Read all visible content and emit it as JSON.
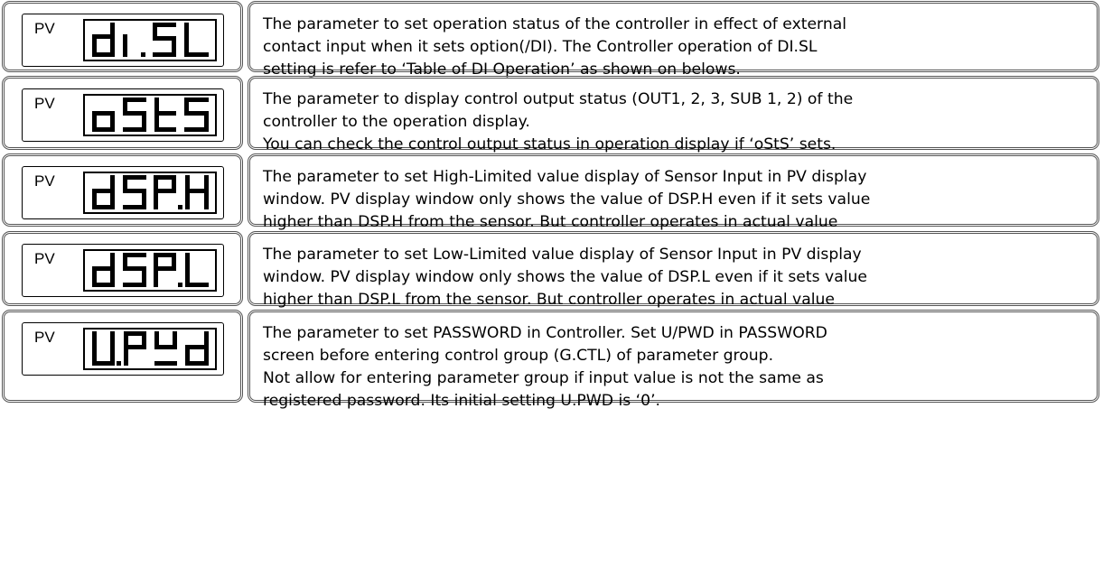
{
  "rows": [
    {
      "pv_label": "PV",
      "display_code": "dI.SL",
      "lines": [
        "The parameter to set operation status of the controller in effect of external",
        "contact input when it sets option(/DI).   The Controller operation of DI.SL",
        "setting is refer to ‘Table of DI Operation’ as shown on belows."
      ]
    },
    {
      "pv_label": "PV",
      "display_code": "oStS",
      "lines": [
        "The parameter to display control output status (OUT1, 2, 3, SUB 1, 2) of the",
        "controller to the operation display.",
        "You can check the control output status in operation display if ‘oStS’ sets."
      ]
    },
    {
      "pv_label": "PV",
      "display_code": "dSP.H",
      "lines": [
        "The parameter to set High-Limited value display of Sensor Input in PV display",
        "window. PV display window only shows the value of DSP.H even if it sets value",
        "higher than DSP.H from the sensor.   But controller operates in actual value"
      ]
    },
    {
      "pv_label": "PV",
      "display_code": "dSP.L",
      "lines": [
        "The parameter to set Low-Limited value display of Sensor Input in PV display",
        "window. PV display window only shows the value of DSP.L even if it sets value",
        "higher than DSP.L from the sensor.   But controller operates in actual value"
      ]
    },
    {
      "pv_label": "PV",
      "display_code": "U.PWd",
      "lines": [
        "The parameter to set PASSWORD in Controller.  Set U/PWD in PASSWORD",
        "screen before entering control group (G.CTL) of parameter group.",
        "Not allow for entering parameter group if input value is not the same as",
        "registered password.   Its initial setting U.PWD is ‘0’."
      ]
    }
  ]
}
